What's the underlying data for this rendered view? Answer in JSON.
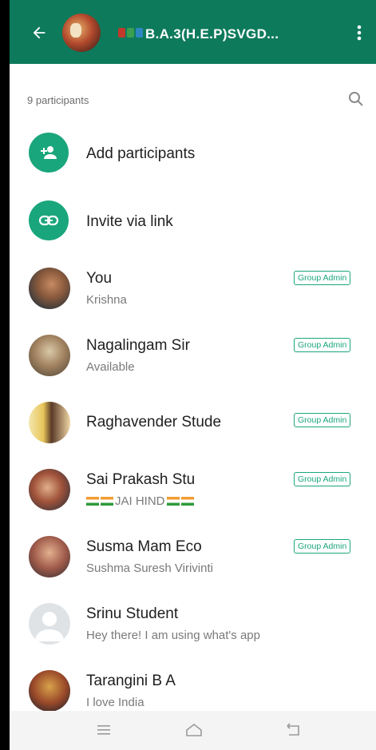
{
  "header": {
    "title": "B.A.3(H.E.P)SVGD...",
    "back_icon": "arrow-left-icon",
    "menu_icon": "more-vert-icon",
    "title_book_icons": [
      "book-icon",
      "book-icon"
    ],
    "color": "#0e7a5c"
  },
  "participants": {
    "count_label": "9 participants",
    "search_icon": "search-icon"
  },
  "actions": [
    {
      "label": "Add participants",
      "icon": "add-person-icon"
    },
    {
      "label": "Invite via link",
      "icon": "link-icon"
    }
  ],
  "members": [
    {
      "name": "You",
      "status": "Krishna",
      "badge": "Group Admin"
    },
    {
      "name": "Nagalingam Sir",
      "status": "Available",
      "badge": "Group Admin"
    },
    {
      "name": "Raghavender Stude",
      "status": "",
      "badge": "Group Admin"
    },
    {
      "name": "Sai Prakash Stu",
      "status": "JAI HIND",
      "badge": "Group Admin"
    },
    {
      "name": "Susma Mam Eco",
      "status": "Sushma Suresh Virivinti",
      "badge": "Group Admin"
    },
    {
      "name": "Srinu Student",
      "status": "Hey there! I am using what's app",
      "badge": ""
    },
    {
      "name": "Tarangini B A",
      "status": "I love India",
      "badge": ""
    }
  ],
  "navbar": {
    "icons": [
      "menu-icon",
      "home-icon",
      "back-icon"
    ]
  },
  "colors": {
    "accent": "#1aa67c",
    "header": "#0e7a5c"
  }
}
